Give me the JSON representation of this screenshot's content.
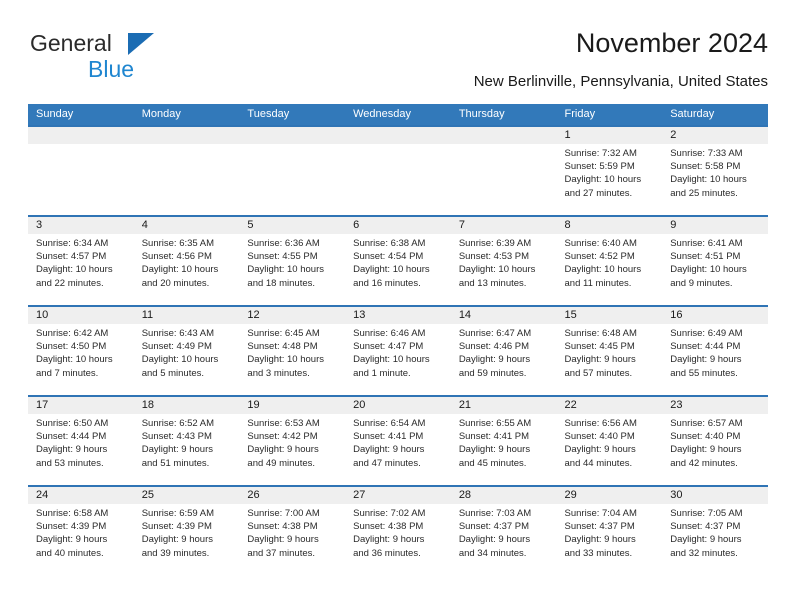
{
  "logo": {
    "word_dark": "General",
    "word_blue": "Blue",
    "triangle_color": "#1b6cb3",
    "blue_color": "#1f86d0"
  },
  "header": {
    "title": "November 2024",
    "location": "New Berlinville, Pennsylvania, United States"
  },
  "colors": {
    "header_blue": "#3279ba",
    "row_rule_blue": "#2f74b5",
    "date_band_gray": "#efefef",
    "text": "#1a1a1a"
  },
  "weekdays": [
    "Sunday",
    "Monday",
    "Tuesday",
    "Wednesday",
    "Thursday",
    "Friday",
    "Saturday"
  ],
  "weeks": [
    [
      {
        "day": "",
        "lines": []
      },
      {
        "day": "",
        "lines": []
      },
      {
        "day": "",
        "lines": []
      },
      {
        "day": "",
        "lines": []
      },
      {
        "day": "",
        "lines": []
      },
      {
        "day": "1",
        "lines": [
          "Sunrise: 7:32 AM",
          "Sunset: 5:59 PM",
          "Daylight: 10 hours",
          "and 27 minutes."
        ]
      },
      {
        "day": "2",
        "lines": [
          "Sunrise: 7:33 AM",
          "Sunset: 5:58 PM",
          "Daylight: 10 hours",
          "and 25 minutes."
        ]
      }
    ],
    [
      {
        "day": "3",
        "lines": [
          "Sunrise: 6:34 AM",
          "Sunset: 4:57 PM",
          "Daylight: 10 hours",
          "and 22 minutes."
        ]
      },
      {
        "day": "4",
        "lines": [
          "Sunrise: 6:35 AM",
          "Sunset: 4:56 PM",
          "Daylight: 10 hours",
          "and 20 minutes."
        ]
      },
      {
        "day": "5",
        "lines": [
          "Sunrise: 6:36 AM",
          "Sunset: 4:55 PM",
          "Daylight: 10 hours",
          "and 18 minutes."
        ]
      },
      {
        "day": "6",
        "lines": [
          "Sunrise: 6:38 AM",
          "Sunset: 4:54 PM",
          "Daylight: 10 hours",
          "and 16 minutes."
        ]
      },
      {
        "day": "7",
        "lines": [
          "Sunrise: 6:39 AM",
          "Sunset: 4:53 PM",
          "Daylight: 10 hours",
          "and 13 minutes."
        ]
      },
      {
        "day": "8",
        "lines": [
          "Sunrise: 6:40 AM",
          "Sunset: 4:52 PM",
          "Daylight: 10 hours",
          "and 11 minutes."
        ]
      },
      {
        "day": "9",
        "lines": [
          "Sunrise: 6:41 AM",
          "Sunset: 4:51 PM",
          "Daylight: 10 hours",
          "and 9 minutes."
        ]
      }
    ],
    [
      {
        "day": "10",
        "lines": [
          "Sunrise: 6:42 AM",
          "Sunset: 4:50 PM",
          "Daylight: 10 hours",
          "and 7 minutes."
        ]
      },
      {
        "day": "11",
        "lines": [
          "Sunrise: 6:43 AM",
          "Sunset: 4:49 PM",
          "Daylight: 10 hours",
          "and 5 minutes."
        ]
      },
      {
        "day": "12",
        "lines": [
          "Sunrise: 6:45 AM",
          "Sunset: 4:48 PM",
          "Daylight: 10 hours",
          "and 3 minutes."
        ]
      },
      {
        "day": "13",
        "lines": [
          "Sunrise: 6:46 AM",
          "Sunset: 4:47 PM",
          "Daylight: 10 hours",
          "and 1 minute."
        ]
      },
      {
        "day": "14",
        "lines": [
          "Sunrise: 6:47 AM",
          "Sunset: 4:46 PM",
          "Daylight: 9 hours",
          "and 59 minutes."
        ]
      },
      {
        "day": "15",
        "lines": [
          "Sunrise: 6:48 AM",
          "Sunset: 4:45 PM",
          "Daylight: 9 hours",
          "and 57 minutes."
        ]
      },
      {
        "day": "16",
        "lines": [
          "Sunrise: 6:49 AM",
          "Sunset: 4:44 PM",
          "Daylight: 9 hours",
          "and 55 minutes."
        ]
      }
    ],
    [
      {
        "day": "17",
        "lines": [
          "Sunrise: 6:50 AM",
          "Sunset: 4:44 PM",
          "Daylight: 9 hours",
          "and 53 minutes."
        ]
      },
      {
        "day": "18",
        "lines": [
          "Sunrise: 6:52 AM",
          "Sunset: 4:43 PM",
          "Daylight: 9 hours",
          "and 51 minutes."
        ]
      },
      {
        "day": "19",
        "lines": [
          "Sunrise: 6:53 AM",
          "Sunset: 4:42 PM",
          "Daylight: 9 hours",
          "and 49 minutes."
        ]
      },
      {
        "day": "20",
        "lines": [
          "Sunrise: 6:54 AM",
          "Sunset: 4:41 PM",
          "Daylight: 9 hours",
          "and 47 minutes."
        ]
      },
      {
        "day": "21",
        "lines": [
          "Sunrise: 6:55 AM",
          "Sunset: 4:41 PM",
          "Daylight: 9 hours",
          "and 45 minutes."
        ]
      },
      {
        "day": "22",
        "lines": [
          "Sunrise: 6:56 AM",
          "Sunset: 4:40 PM",
          "Daylight: 9 hours",
          "and 44 minutes."
        ]
      },
      {
        "day": "23",
        "lines": [
          "Sunrise: 6:57 AM",
          "Sunset: 4:40 PM",
          "Daylight: 9 hours",
          "and 42 minutes."
        ]
      }
    ],
    [
      {
        "day": "24",
        "lines": [
          "Sunrise: 6:58 AM",
          "Sunset: 4:39 PM",
          "Daylight: 9 hours",
          "and 40 minutes."
        ]
      },
      {
        "day": "25",
        "lines": [
          "Sunrise: 6:59 AM",
          "Sunset: 4:39 PM",
          "Daylight: 9 hours",
          "and 39 minutes."
        ]
      },
      {
        "day": "26",
        "lines": [
          "Sunrise: 7:00 AM",
          "Sunset: 4:38 PM",
          "Daylight: 9 hours",
          "and 37 minutes."
        ]
      },
      {
        "day": "27",
        "lines": [
          "Sunrise: 7:02 AM",
          "Sunset: 4:38 PM",
          "Daylight: 9 hours",
          "and 36 minutes."
        ]
      },
      {
        "day": "28",
        "lines": [
          "Sunrise: 7:03 AM",
          "Sunset: 4:37 PM",
          "Daylight: 9 hours",
          "and 34 minutes."
        ]
      },
      {
        "day": "29",
        "lines": [
          "Sunrise: 7:04 AM",
          "Sunset: 4:37 PM",
          "Daylight: 9 hours",
          "and 33 minutes."
        ]
      },
      {
        "day": "30",
        "lines": [
          "Sunrise: 7:05 AM",
          "Sunset: 4:37 PM",
          "Daylight: 9 hours",
          "and 32 minutes."
        ]
      }
    ]
  ]
}
